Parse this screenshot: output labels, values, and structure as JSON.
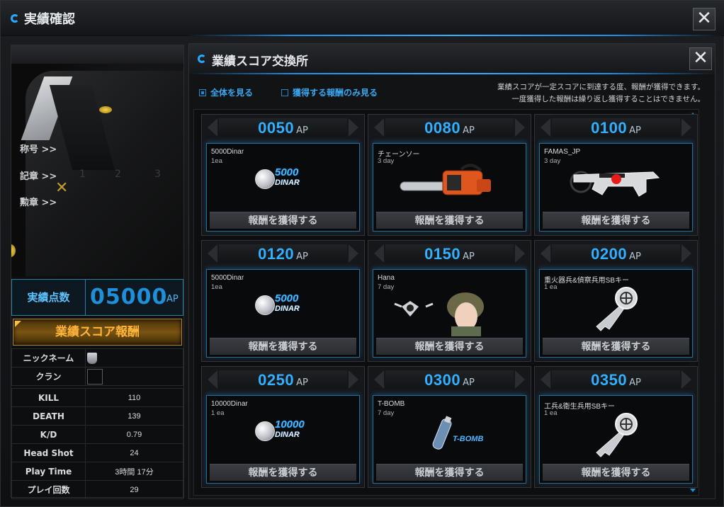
{
  "window": {
    "title": "実績確認",
    "close_symbol": "✕"
  },
  "left": {
    "rank_labels": [
      "称号 >>",
      "記章 >>",
      "勲章 >>"
    ],
    "slot_numbers": [
      "1",
      "2",
      "3"
    ],
    "score": {
      "label": "実績点数",
      "value": "05000",
      "unit": "AP"
    },
    "reward_button": "業績スコア報酬",
    "profile": [
      {
        "key": "ニックネーム",
        "value": ""
      },
      {
        "key": "クラン",
        "value": ""
      }
    ],
    "stats": [
      {
        "key": "KILL",
        "value": "110"
      },
      {
        "key": "DEATH",
        "value": "139"
      },
      {
        "key": "K/D",
        "value": "0.79"
      },
      {
        "key": "Head Shot",
        "value": "24"
      },
      {
        "key": "Play Time",
        "value": "3時間 17分"
      },
      {
        "key": "プレイ回数",
        "value": "29"
      }
    ]
  },
  "exchange": {
    "title": "業績スコア交換所",
    "close_symbol": "✕",
    "filters": [
      {
        "label": "全体を見る",
        "selected": true
      },
      {
        "label": "獲得する報酬のみ見る",
        "selected": false
      }
    ],
    "notice": [
      "業績スコアが一定スコアに到達する度、報酬が獲得できます。",
      "一度獲得した報酬は繰り返し獲得することはできません。"
    ],
    "claim_label": "報酬を獲得する",
    "ap_unit": "AP",
    "rewards": [
      {
        "ap": "0050",
        "name": "5000Dinar",
        "duration": "1ea",
        "icon": "dinar-coin-icon",
        "coin_l1": "5000",
        "coin_l2": "DINAR"
      },
      {
        "ap": "0080",
        "name": "チェーンソー",
        "duration": "3 day",
        "icon": "chainsaw-icon"
      },
      {
        "ap": "0100",
        "name": "FAMAS_JP",
        "duration": "3 day",
        "icon": "rifle-icon"
      },
      {
        "ap": "0120",
        "name": "5000Dinar",
        "duration": "1ea",
        "icon": "dinar-coin-icon",
        "coin_l1": "5000",
        "coin_l2": "DINAR"
      },
      {
        "ap": "0150",
        "name": "Hana",
        "duration": "7 day",
        "icon": "character-icon"
      },
      {
        "ap": "0200",
        "name": "重火器兵&偵察兵用SBキー",
        "duration": "1 ea",
        "icon": "key-icon"
      },
      {
        "ap": "0250",
        "name": "10000Dinar",
        "duration": "1 ea",
        "icon": "dinar-coin-icon",
        "coin_l1": "10000",
        "coin_l2": "DINAR"
      },
      {
        "ap": "0300",
        "name": "T-BOMB",
        "duration": "7 day",
        "icon": "t-bomb-icon",
        "bomb_label": "T-BOMB"
      },
      {
        "ap": "0350",
        "name": "工兵&衛生兵用SBキー",
        "duration": "1 ea",
        "icon": "key-icon"
      }
    ]
  },
  "colors": {
    "accent": "#32b0ff",
    "gold": "#ffb43a",
    "panel": "#121315"
  }
}
